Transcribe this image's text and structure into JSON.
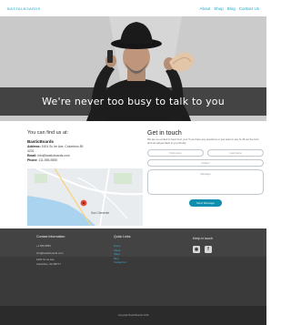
{
  "header": {
    "brand": "BASTALBOARDS",
    "nav": [
      "About",
      "Shop",
      "Blog",
      "Contact Us"
    ]
  },
  "hero": {
    "title": "We're never too busy to talk to you"
  },
  "find_us": {
    "heading": "You can find us at:",
    "business_name": "BasticBoards",
    "address_label": "Address:",
    "address_value": "1604 Sc Ire Ave, Columbus 89",
    "address_line2": "4231",
    "email_label": "Email:",
    "email_value": "info@basticboards.com",
    "phone_label": "Phone:",
    "phone_value": "111-555-5555",
    "map_place": "San Clemente"
  },
  "contact": {
    "heading": "Get in touch",
    "intro": "We are so excited to hear from you! If you have any questions or just want to say hi, fill out the form and we will get back to you shortly.",
    "first_name_placeholder": "First name",
    "last_name_placeholder": "Last name",
    "subject_placeholder": "Subject",
    "message_placeholder": "Message",
    "submit_label": "Send Message"
  },
  "footer": {
    "contact_heading": "Contact Information",
    "phone": "+1 555-5555",
    "email": "info@basticboards.com",
    "address1": "1604 Sc Ire Ave",
    "address2": "Columbus, OH 89777",
    "links_heading": "Quick Links",
    "links": [
      "Home",
      "About",
      "Shop",
      "Blog",
      "Contact Us"
    ],
    "social_heading": "Keep in touch",
    "copyright": "Copyright BasticBoards 2019"
  },
  "colors": {
    "accent": "#1ea6c8",
    "button": "#0f8fb0",
    "footer": "#3a3a3a"
  }
}
